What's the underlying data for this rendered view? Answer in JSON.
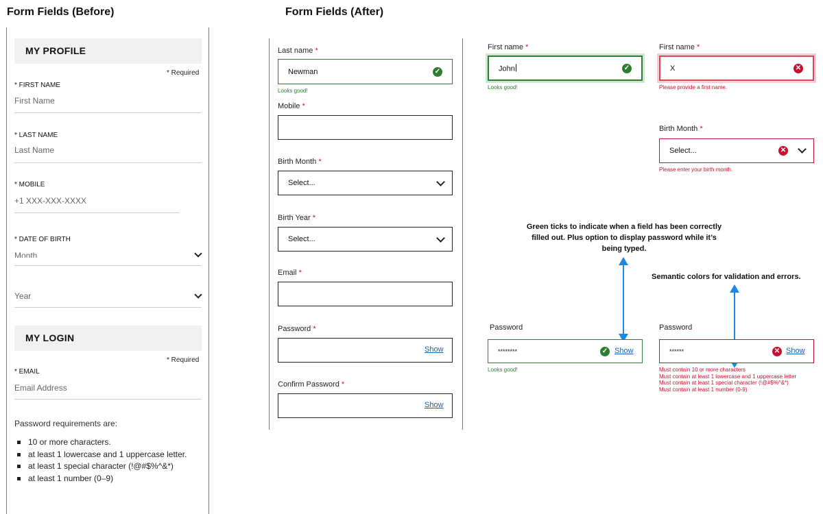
{
  "headings": {
    "before": "Form Fields (Before)",
    "after": "Form Fields (After)"
  },
  "before": {
    "profile_title": "MY PROFILE",
    "required_note": "* Required",
    "first_name_label": "* FIRST NAME",
    "first_name_placeholder": "First Name",
    "last_name_label": "* LAST NAME",
    "last_name_placeholder": "Last Name",
    "mobile_label": "* MOBILE",
    "mobile_placeholder": "+1 XXX-XXX-XXXX",
    "dob_label": "* DATE OF BIRTH",
    "month_placeholder": "Month",
    "year_placeholder": "Year",
    "login_title": "MY LOGIN",
    "login_required_note": "* Required",
    "email_label": "* EMAIL",
    "email_placeholder": "Email Address",
    "password_intro": "Password requirements are:",
    "requirements": [
      "10 or more characters.",
      "at least 1 lowercase and 1 uppercase letter.",
      "at least 1 special character (!@#$%^&*)",
      "at least 1 number (0–9)"
    ]
  },
  "after_form": {
    "last_name_label": "Last name",
    "last_name_value": "Newman",
    "last_name_ok": "Looks good!",
    "mobile_label": "Mobile",
    "birth_month_label": "Birth Month",
    "birth_month_value": "Select...",
    "birth_year_label": "Birth Year",
    "birth_year_value": "Select...",
    "email_label": "Email",
    "password_label": "Password",
    "password_show": "Show",
    "confirm_label": "Confirm Password",
    "confirm_show": "Show",
    "asterisk": "*"
  },
  "examples": {
    "first_ok_label": "First name",
    "first_ok_value": "John",
    "first_ok_msg": "Looks good!",
    "first_err_label": "First name",
    "first_err_value": "X",
    "first_err_msg": "Please provide a first name.",
    "month_err_label": "Birth Month",
    "month_err_value": "Select...",
    "month_err_msg": "Please enter your birth month.",
    "annotation_green": "Green ticks to indicate when a field has been correctly filled out. Plus option to display password while it’s being typed.",
    "annotation_semantic": "Semantic colors for validation and errors.",
    "pw_ok_label": "Password",
    "pw_ok_value": "********",
    "pw_ok_show": "Show",
    "pw_ok_msg": "Looks good!",
    "pw_err_label": "Password",
    "pw_err_value": "******",
    "pw_err_show": "Show",
    "pw_err_msgs": [
      "Must contain 10 or more characters",
      "Must contain at least 1 lowercase and 1 uppercase letter",
      "Must contain at least 1 special character (!@#$%^&*)",
      "Must contain at least 1 number (0-9)"
    ]
  },
  "icons": {
    "ok": "check-circle-icon",
    "error": "x-circle-icon",
    "dropdown": "chevron-down-icon"
  },
  "colors": {
    "success": "#2e7d32",
    "error": "#c8102e",
    "link": "#1a5fa8",
    "arrow": "#1e88e5"
  }
}
